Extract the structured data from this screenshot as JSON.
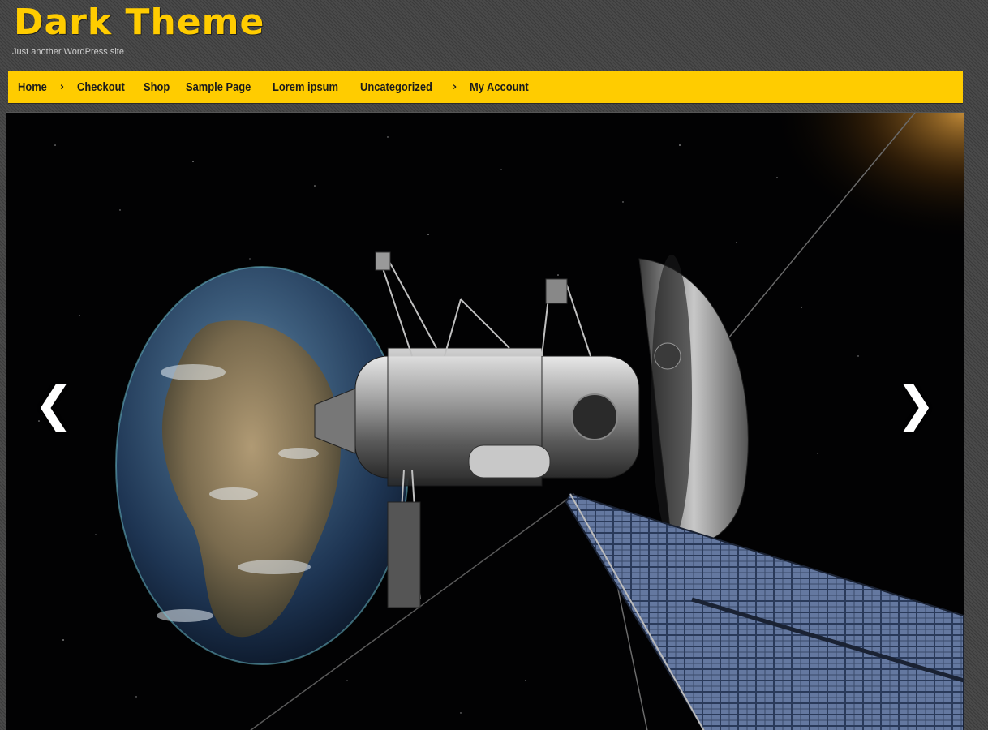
{
  "site": {
    "title": "Dark Theme",
    "tagline": "Just another WordPress site"
  },
  "nav": {
    "items": [
      {
        "label": "Home",
        "has_submenu": true
      },
      {
        "label": "Checkout",
        "has_submenu": false
      },
      {
        "label": "Shop",
        "has_submenu": false
      },
      {
        "label": "Sample Page",
        "has_submenu": false
      },
      {
        "label": "Lorem ipsum",
        "has_submenu": false
      },
      {
        "label": "Uncategorized",
        "has_submenu": true
      },
      {
        "label": "My Account",
        "has_submenu": false
      }
    ],
    "submenu_glyph": "›"
  },
  "slider": {
    "image_subject": "satellite-orbiting-earth-in-space",
    "prev_glyph": "❮",
    "next_glyph": "❯"
  },
  "colors": {
    "accent": "#ffcc00",
    "background": "#444444",
    "nav_text": "#1b1b1b"
  }
}
